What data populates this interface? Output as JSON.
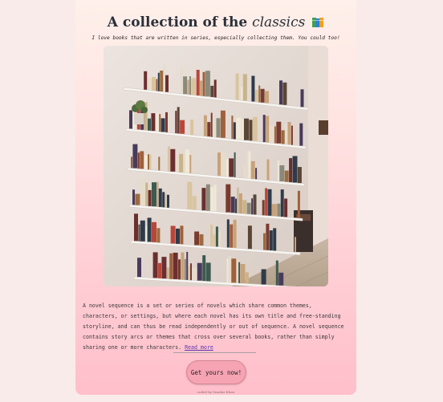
{
  "header": {
    "title_prefix": "A collection of the",
    "title_emphasis": "classics",
    "icon": "books-icon",
    "subtitle": "I love books that are written in series, especially collecting them. You could too!"
  },
  "image": {
    "icon": "bookshelf-photo"
  },
  "content": {
    "description": "A novel sequence is a set or series of novels which share common themes, characters, or settings, but where each novel has its own title and free-standing storyline, and can thus be read independently or out of sequence. A novel sequence contains story arcs or themes that cross over several books, rather than simply sharing one or more characters.",
    "read_more": "Read more"
  },
  "cta": {
    "label": "Get yours now!"
  },
  "footer": {
    "credit": "coded by Sundus Khan"
  },
  "colors": {
    "page_background": "#f8ebea",
    "card_top": "#fef0ea",
    "card_bottom": "#ffbfcb",
    "button": "#f6a3b3",
    "link": "#5b35b0"
  }
}
